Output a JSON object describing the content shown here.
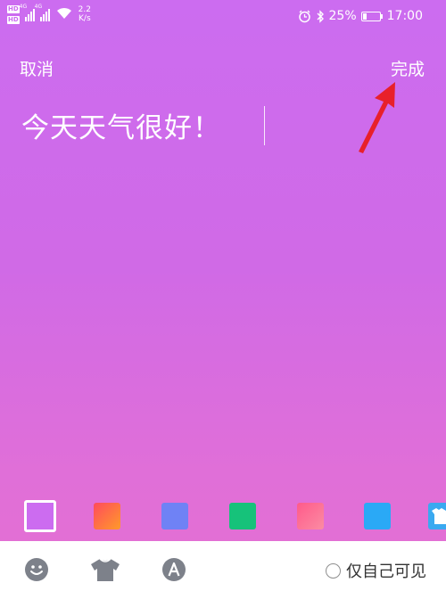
{
  "status_bar": {
    "sim1": "HD",
    "sim2": "HD",
    "net1": "4G",
    "net2": "4G",
    "speed_value": "2.2",
    "speed_unit": "K/s",
    "battery": "25%",
    "battery_level": 0.25,
    "time": "17:00"
  },
  "header": {
    "cancel_label": "取消",
    "done_label": "完成"
  },
  "editor": {
    "text": "今天天气很好！"
  },
  "swatches": [
    {
      "name": "theme-1",
      "color": "#cc6cf0",
      "selected": true
    },
    {
      "name": "theme-2",
      "color": "#ff6a3d",
      "selected": false
    },
    {
      "name": "theme-3",
      "color": "#6f82f5",
      "selected": false
    },
    {
      "name": "theme-4",
      "color": "#16c27a",
      "selected": false
    },
    {
      "name": "theme-5",
      "color": "#fb6e96",
      "selected": false
    },
    {
      "name": "theme-6",
      "color": "#2aa9f6",
      "selected": false
    },
    {
      "name": "theme-7",
      "color": "#3aa9f0",
      "selected": false
    }
  ],
  "toolbar": {
    "icons": [
      "emoji-icon",
      "tshirt-icon",
      "font-icon"
    ],
    "private_label": "仅自己可见",
    "private_checked": false
  },
  "colors": {
    "arrow": "#e8202a",
    "icon_gray": "#7d818a"
  }
}
